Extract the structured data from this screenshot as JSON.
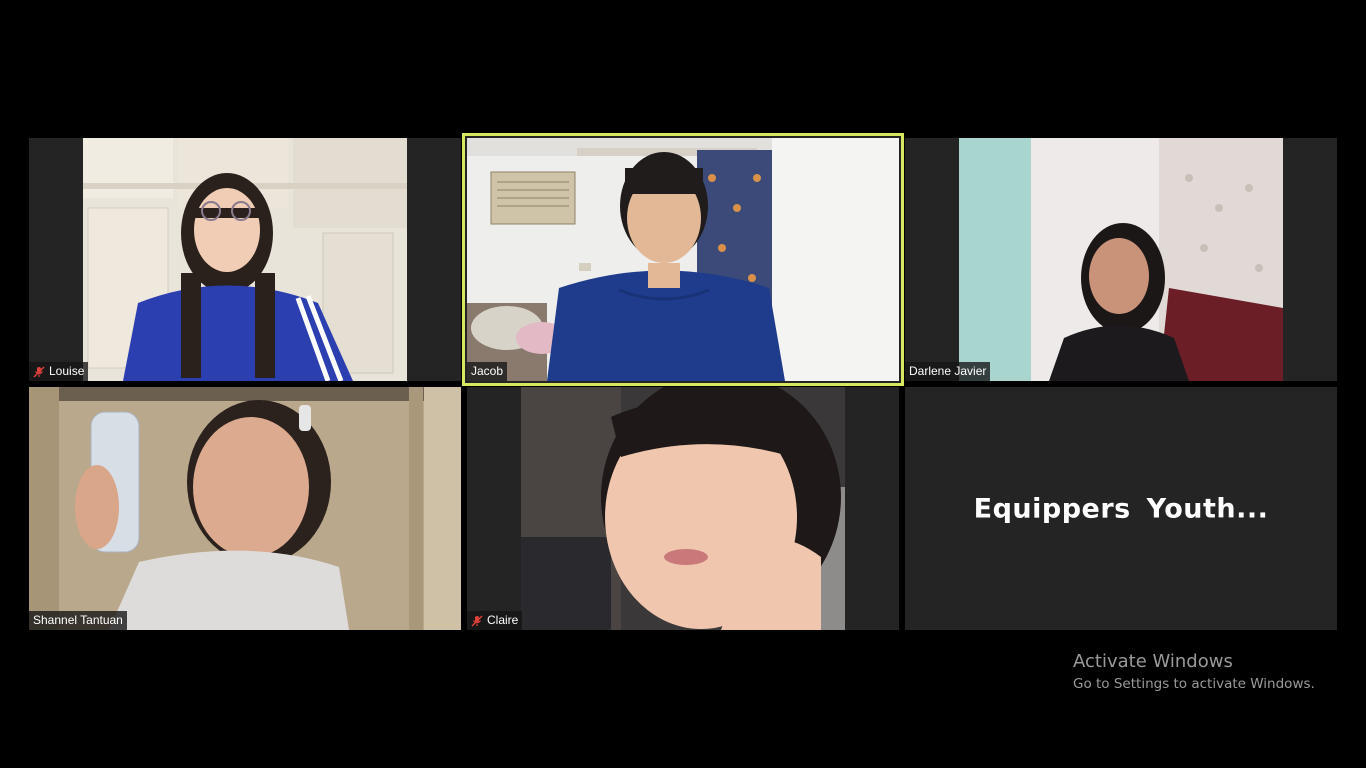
{
  "participants": [
    {
      "name": "Louise",
      "muted": true
    },
    {
      "name": "Jacob",
      "muted": false,
      "active_speaker": true
    },
    {
      "name": "Darlene Javier",
      "muted": false
    },
    {
      "name": "Shannel Tantuan",
      "muted": false
    },
    {
      "name": "Claire",
      "muted": true
    },
    {
      "display_name": "Equippers  Youth...",
      "video_off": true
    }
  ],
  "colors": {
    "background": "#000000",
    "tile_background": "#242424",
    "active_speaker_border": "#d7e85f",
    "mute_icon": "#e0413a"
  },
  "watermark": {
    "title": "Activate Windows",
    "subtitle": "Go to Settings to activate Windows."
  }
}
